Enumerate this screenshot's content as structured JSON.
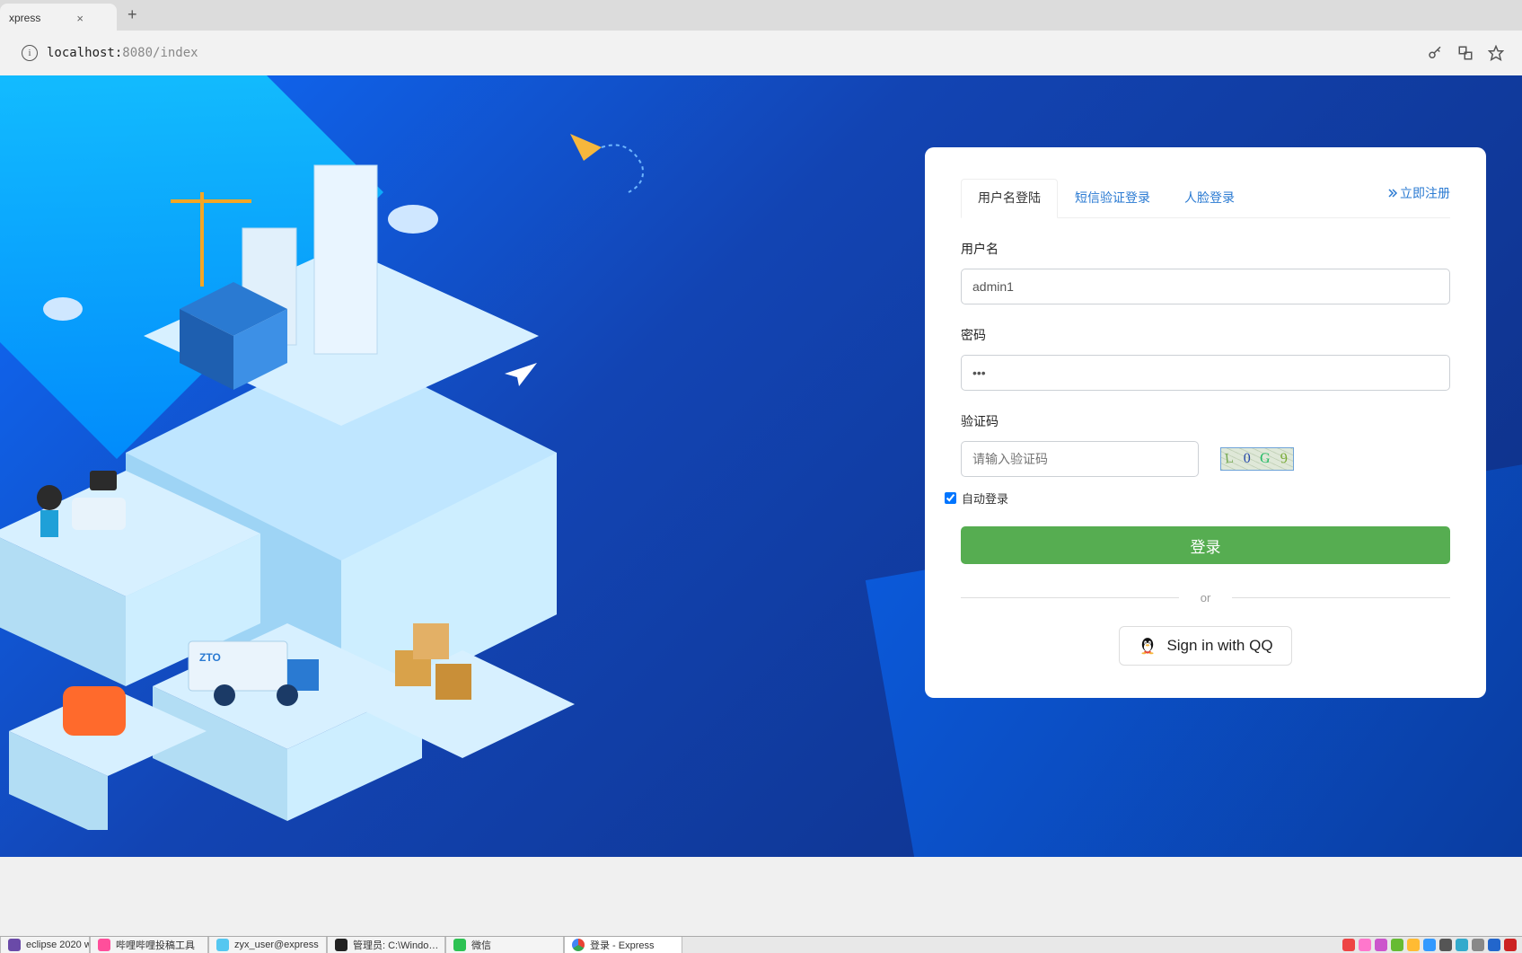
{
  "browser": {
    "tab_title": "xpress",
    "url_host": "localhost:",
    "url_port_path": "8080/index"
  },
  "login": {
    "tabs": {
      "username": "用户名登陆",
      "sms": "短信验证登录",
      "face": "人脸登录"
    },
    "register": "立即注册",
    "labels": {
      "username": "用户名",
      "password": "密码",
      "captcha": "验证码"
    },
    "values": {
      "username": "admin1",
      "password": "•••"
    },
    "placeholders": {
      "captcha": "请输入验证码"
    },
    "captcha_chars": [
      "L",
      "0",
      "G",
      "9"
    ],
    "auto_login": "自动登录",
    "auto_login_checked": true,
    "submit": "登录",
    "divider": "or",
    "qq": "Sign in with QQ"
  },
  "taskbar": {
    "items": [
      "eclipse 2020 wor…",
      "哔哩哔哩投稿工具",
      "zyx_user@express",
      "管理员: C:\\Windo…",
      "微信",
      "登录 - Express"
    ]
  },
  "colors": {
    "accent_green": "#56ad51",
    "link_blue": "#2a7ad2"
  }
}
